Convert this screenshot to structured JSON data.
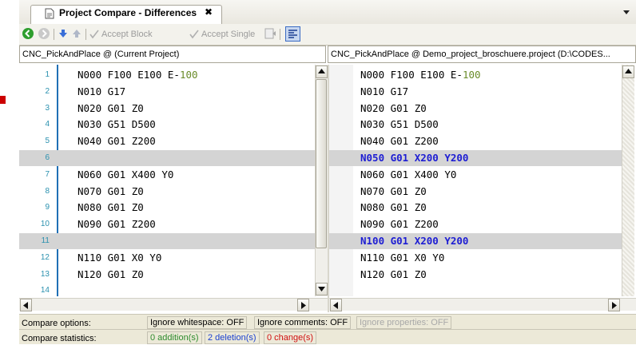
{
  "tab": {
    "title": "Project Compare - Differences",
    "close": "✖"
  },
  "toolbar": {
    "accept_block": "Accept Block",
    "accept_single": "Accept Single"
  },
  "left": {
    "header": "CNC_PickAndPlace @ (Current Project)",
    "lines": [
      {
        "num": "1",
        "text": "N000 F100 E100 E-",
        "num_suffix": "100",
        "gray": false
      },
      {
        "num": "2",
        "text": "N010 G17",
        "gray": false
      },
      {
        "num": "3",
        "text": "N020 G01 Z0",
        "gray": false
      },
      {
        "num": "4",
        "text": "N030 G51 D500",
        "gray": false
      },
      {
        "num": "5",
        "text": "N040 G01 Z200",
        "gray": false
      },
      {
        "num": "6",
        "text": "",
        "gray": true
      },
      {
        "num": "7",
        "text": "N060 G01 X400 Y0",
        "gray": false
      },
      {
        "num": "8",
        "text": "N070 G01 Z0",
        "gray": false
      },
      {
        "num": "9",
        "text": "N080 G01 Z0",
        "gray": false
      },
      {
        "num": "10",
        "text": "N090 G01 Z200",
        "gray": false
      },
      {
        "num": "11",
        "text": "",
        "gray": true
      },
      {
        "num": "12",
        "text": "N110 G01 X0 Y0",
        "gray": false
      },
      {
        "num": "13",
        "text": "N120 G01 Z0",
        "gray": false
      },
      {
        "num": "14",
        "text": "",
        "gray": false
      }
    ]
  },
  "right": {
    "header": "CNC_PickAndPlace  @  Demo_project_broschuere.project (D:\\CODES...",
    "lines": [
      {
        "text": "N000 F100 E100 E-",
        "num_suffix": "100",
        "gray": false
      },
      {
        "text": "N010 G17",
        "gray": false
      },
      {
        "text": "N020 G01 Z0",
        "gray": false
      },
      {
        "text": "N030 G51 D500",
        "gray": false
      },
      {
        "text": "N040 G01 Z200",
        "gray": false
      },
      {
        "text": "N050 G01 X200 Y200",
        "gray": true,
        "bold": true
      },
      {
        "text": "N060 G01 X400 Y0",
        "gray": false
      },
      {
        "text": "N070 G01 Z0",
        "gray": false
      },
      {
        "text": "N080 G01 Z0",
        "gray": false
      },
      {
        "text": "N090 G01 Z200",
        "gray": false
      },
      {
        "text": "N100 G01 X200 Y200",
        "gray": true,
        "bold": true
      },
      {
        "text": "N110 G01 X0 Y0",
        "gray": false
      },
      {
        "text": "N120 G01 Z0",
        "gray": false
      }
    ]
  },
  "status": {
    "options_label": "Compare options:",
    "ignore_whitespace": "Ignore whitespace: OFF",
    "ignore_comments": "Ignore comments: OFF",
    "ignore_properties": "Ignore properties: OFF",
    "stats_label": "Compare statistics:",
    "additions": "0 addition(s)",
    "deletions": "2 deletion(s)",
    "changes": "0 change(s)"
  },
  "colors": {
    "additions": "#2e8b2e",
    "deletions": "#1a3fd0",
    "changes": "#d01010",
    "line_number": "#2b91af"
  }
}
